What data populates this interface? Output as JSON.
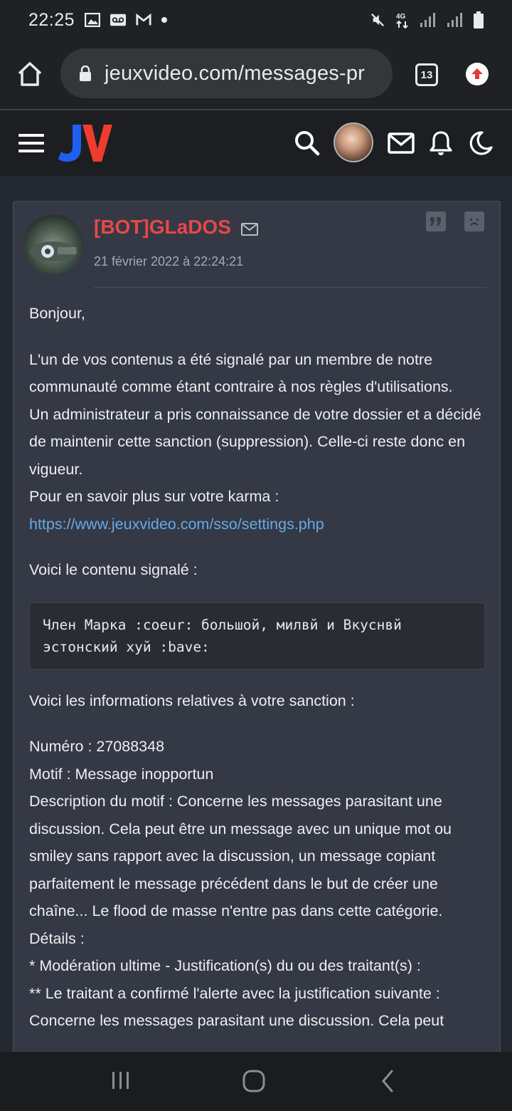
{
  "status_bar": {
    "time": "22:25",
    "left_icons": [
      "image-icon",
      "voicemail-icon",
      "gmail-icon",
      "dot-icon"
    ],
    "right_icons": [
      "mute-icon",
      "4g-icon",
      "signal-icon",
      "signal-icon",
      "battery-icon"
    ],
    "network_label": "4G"
  },
  "browser": {
    "url": "jeuxvideo.com/messages-pr",
    "tab_count": "13"
  },
  "site_header": {
    "logo": "JV",
    "icons": [
      "menu-icon",
      "search-icon",
      "avatar",
      "mail-icon",
      "bell-icon",
      "moon-icon"
    ]
  },
  "message": {
    "author": "[BOT]GLaDOS",
    "date": "21 février 2022 à 22:24:21",
    "greeting": "Bonjour,",
    "para1_line1": "L'un de vos contenus a été signalé par un membre de notre communauté comme étant contraire à nos règles d'utilisations.",
    "para1_line2": "Un administrateur a pris connaissance de votre dossier et a décidé de maintenir cette sanction (suppression). Celle-ci reste donc en vigueur.",
    "para1_line3": "Pour en savoir plus sur votre karma :",
    "karma_link": "https://www.jeuxvideo.com/sso/settings.php",
    "reported_label": "Voici le contenu signalé :",
    "reported_content": "Член Марка :coeur: большой, милвй и Вкуснвй эстонский хуй :bave:",
    "sanction_label": "Voici les informations relatives à votre sanction :",
    "numero": "Numéro : 27088348",
    "motif": "Motif : Message inopportun",
    "description": "Description du motif : Concerne les messages parasitant une discussion. Cela peut être un message avec un unique mot ou smiley sans rapport avec la discussion, un message copiant parfaitement le message précédent dans le but de créer une chaîne... Le flood de masse n'entre pas dans cette catégorie.",
    "details": "Détails :",
    "moderation": "* Modération ultime - Justification(s) du ou des traitant(s) :",
    "traitant": "** Le traitant a confirmé l'alerte avec la justification suivante :",
    "traitant_text": "Concerne les messages parasitant une discussion. Cela peut"
  },
  "colors": {
    "background": "#242831",
    "card": "#343945",
    "author": "#e8474a",
    "link": "#67a9e6"
  }
}
